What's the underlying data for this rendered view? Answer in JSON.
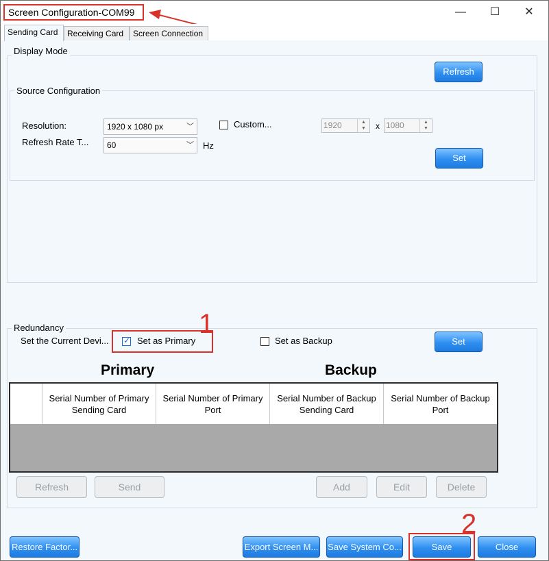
{
  "window": {
    "title": "Screen Configuration-COM99",
    "controls": {
      "minimize": "—",
      "maximize": "☐",
      "close": "✕"
    }
  },
  "tabs": [
    {
      "label": "Sending Card",
      "active": true
    },
    {
      "label": "Receiving Card",
      "active": false
    },
    {
      "label": "Screen Connection",
      "active": false
    }
  ],
  "display_mode": {
    "label": "Display Mode",
    "refresh_label": "Refresh",
    "source_config": {
      "label": "Source Configuration",
      "resolution_label": "Resolution:",
      "resolution_value": "1920 x 1080 px",
      "custom_label": "Custom...",
      "custom_checked": false,
      "width_value": "1920",
      "x_label": "x",
      "height_value": "1080",
      "refresh_rate_label": "Refresh Rate T...",
      "refresh_rate_value": "60",
      "hz_label": "Hz",
      "set_label": "Set"
    }
  },
  "redundancy": {
    "label": "Redundancy",
    "current_device_label": "Set the Current Devi...",
    "primary_checkbox_label": "Set as Primary",
    "primary_checked": true,
    "backup_checkbox_label": "Set as Backup",
    "backup_checked": false,
    "set_label": "Set",
    "primary_heading": "Primary",
    "backup_heading": "Backup",
    "table_headers": [
      "Serial Number of Primary Sending Card",
      "Serial Number of Primary Port",
      "Serial Number of Backup Sending Card",
      "Serial Number of Backup Port"
    ],
    "buttons": {
      "refresh": "Refresh",
      "send": "Send",
      "add": "Add",
      "edit": "Edit",
      "delete": "Delete"
    }
  },
  "footer": {
    "restore_label": "Restore Factor...",
    "export_label": "Export Screen M...",
    "save_system_label": "Save System Co...",
    "save_label": "Save",
    "close_label": "Close"
  },
  "annotations": {
    "marker_1": "1",
    "marker_2": "2"
  },
  "colors": {
    "accent_blue": "#2f8ff0",
    "annotation_red": "#d9322a",
    "panel_bg": "#f3f8fc"
  }
}
